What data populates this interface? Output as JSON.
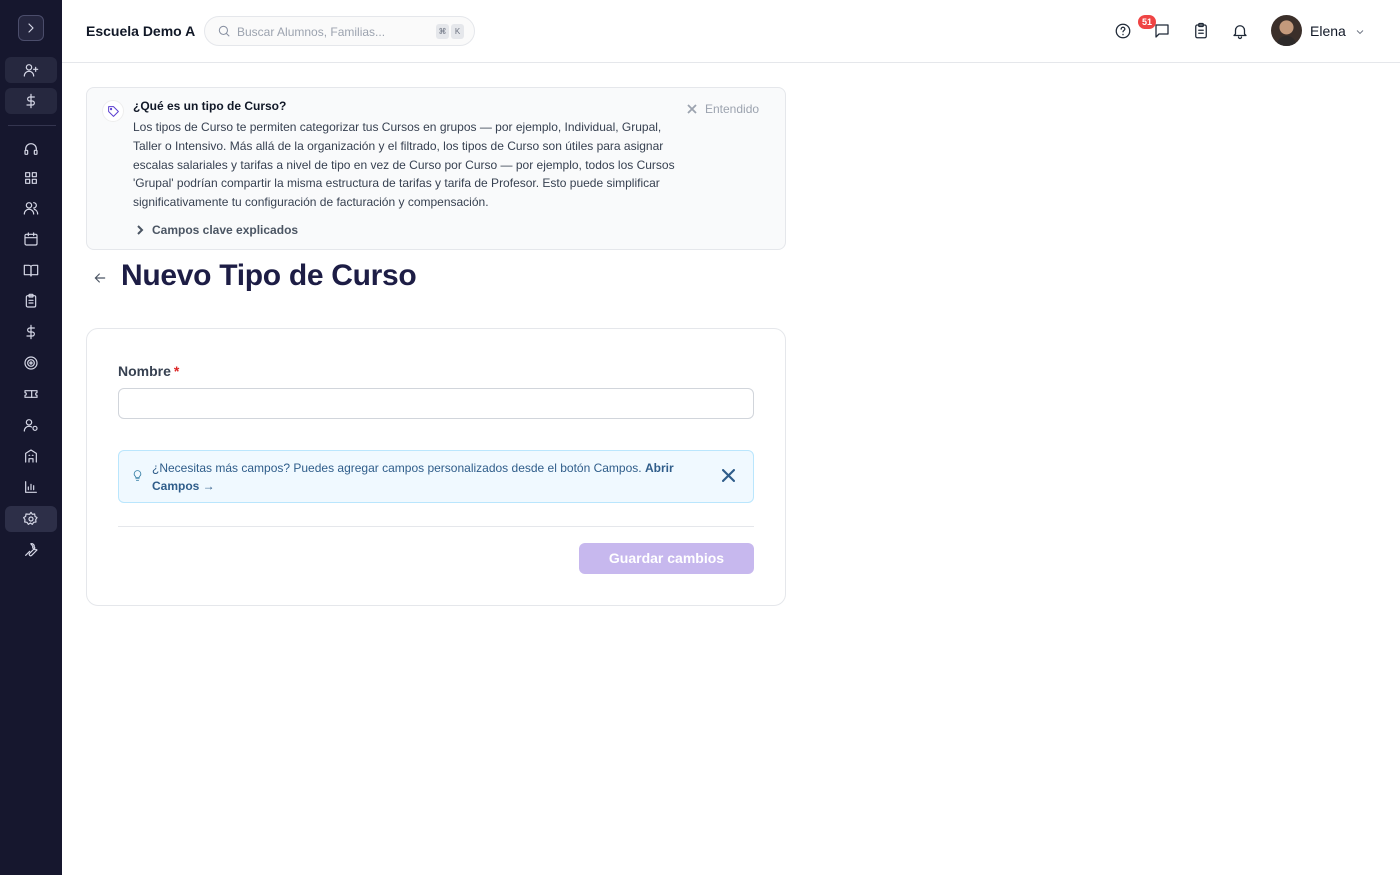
{
  "sidebar": {
    "items": [
      {
        "icon": "user-plus-icon"
      },
      {
        "icon": "dollar-icon"
      },
      {
        "icon": "headset-icon"
      },
      {
        "icon": "dashboard-icon"
      },
      {
        "icon": "users-icon"
      },
      {
        "icon": "calendar-icon"
      },
      {
        "icon": "book-open-icon"
      },
      {
        "icon": "clipboard-icon"
      },
      {
        "icon": "dollar-icon"
      },
      {
        "icon": "target-icon"
      },
      {
        "icon": "ticket-icon"
      },
      {
        "icon": "user-settings-icon"
      },
      {
        "icon": "building-icon"
      },
      {
        "icon": "bar-chart-icon"
      },
      {
        "icon": "settings-icon"
      },
      {
        "icon": "wrench-icon"
      }
    ]
  },
  "header": {
    "school": "Escuela Demo A",
    "search_placeholder": "Buscar Alumnos, Familias...",
    "shortcut_mod": "⌘",
    "shortcut_key": "K",
    "tasks_badge": "51",
    "user_name": "Elena"
  },
  "info_panel": {
    "title": "¿Qué es un tipo de Curso?",
    "body": "Los tipos de Curso te permiten categorizar tus Cursos en grupos — por ejemplo, Individual, Grupal, Taller o Intensivo. Más allá de la organización y el filtrado, los tipos de Curso son útiles para asignar escalas salariales y tarifas a nivel de tipo en vez de Curso por Curso — por ejemplo, todos los Cursos 'Grupal' podrían compartir la misma estructura de tarifas y tarifa de Profesor. Esto puede simplificar significativamente tu configuración de facturación y compensación.",
    "dismiss": "Entendido",
    "key_fields": "Campos clave explicados"
  },
  "page": {
    "title": "Nuevo Tipo de Curso"
  },
  "form": {
    "name_label": "Nombre",
    "required_mark": "*",
    "name_value": "",
    "tip_text": "¿Necesitas más campos? Puedes agregar campos personalizados desde el botón Campos.",
    "tip_link": "Abrir Campos →",
    "save_label": "Guardar cambios"
  },
  "colors": {
    "sidebar_bg": "#16172e",
    "accent_disabled": "#c7b8ee",
    "title": "#1d1d45",
    "badge": "#ef4444"
  }
}
